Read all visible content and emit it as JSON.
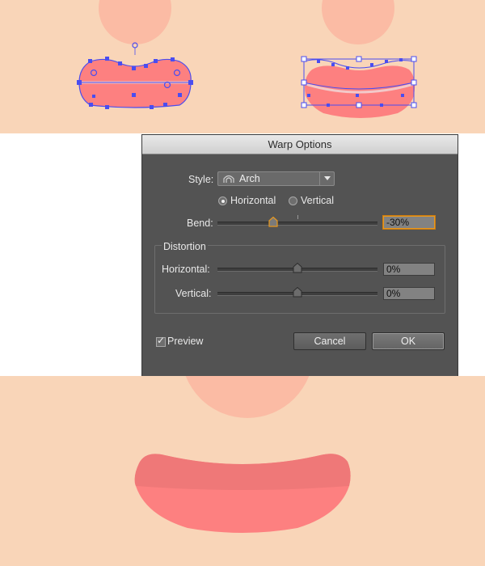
{
  "dialog": {
    "title": "Warp Options",
    "style_label": "Style:",
    "style_value": "Arch",
    "style_icon": "arch-icon",
    "orientation": {
      "horizontal_label": "Horizontal",
      "vertical_label": "Vertical",
      "selected": "Horizontal"
    },
    "bend": {
      "label": "Bend:",
      "value": "-30%",
      "fraction": 0.35
    },
    "distortion": {
      "group_label": "Distortion",
      "horizontal_label": "Horizontal:",
      "horizontal_value": "0%",
      "horizontal_fraction": 0.5,
      "vertical_label": "Vertical:",
      "vertical_value": "0%",
      "vertical_fraction": 0.5
    },
    "preview_label": "Preview",
    "preview_checked": true,
    "cancel_label": "Cancel",
    "ok_label": "OK"
  },
  "colors": {
    "skin": "#f9d5b8",
    "cheek": "#fbbba4",
    "mouth": "#fd8080",
    "mouth_dark": "#ef7878",
    "selection": "#4a4df0",
    "highlight": "#f3b7a8",
    "dialog_bg": "#535353",
    "focus": "#e8981e"
  }
}
